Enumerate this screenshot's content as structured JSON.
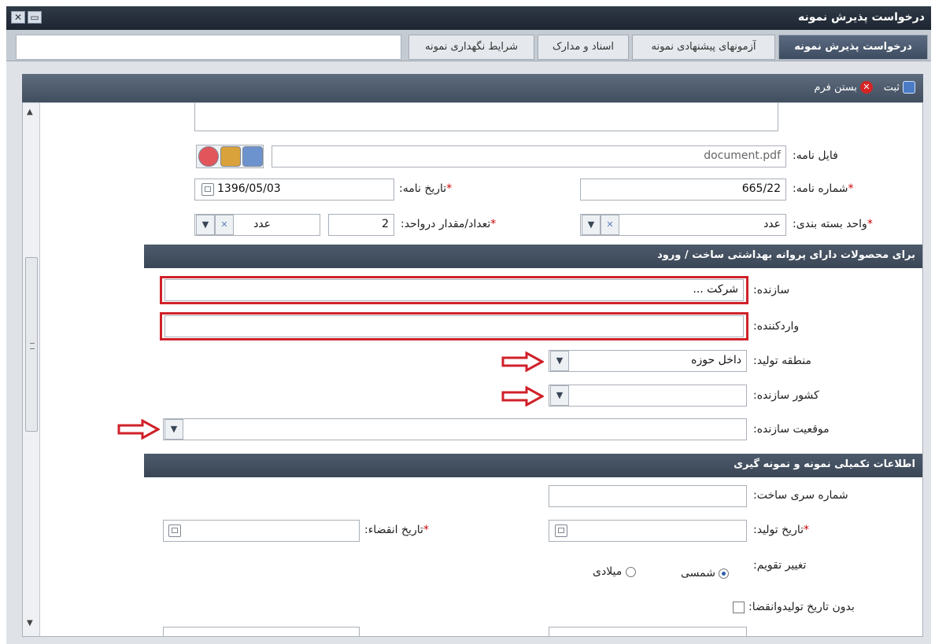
{
  "window": {
    "title": "درخواست پذیرش نمونه"
  },
  "tabs": [
    {
      "label": "درخواست پذیرش نمونه",
      "active": true
    },
    {
      "label": "آزمونهای پیشنهادی نمونه"
    },
    {
      "label": "اسناد و مدارک"
    },
    {
      "label": "شرایط نگهداری نمونه"
    }
  ],
  "toolbar": {
    "save_label": "ثبت",
    "close_label": "بستن فرم"
  },
  "form": {
    "file_label": "فایل نامه:",
    "file_value": "document.pdf",
    "letter_number_label": "شماره نامه:",
    "letter_number_value": "665/22",
    "letter_date_label": "تاریخ نامه:",
    "letter_date_value": "1396/05/03",
    "pack_unit_label": "واحد بسته بندی:",
    "pack_unit_value": "عدد",
    "qty_label": "تعداد/مقدار درواحد:",
    "qty_value": "2",
    "qty_unit_value": "عدد",
    "section1_title": "برای محصولات دارای پروانه بهداشتی ساخت / ورود",
    "manufacturer_label": "سازنده:",
    "manufacturer_value": "شرکت ...",
    "importer_label": "واردکننده:",
    "region_label": "منطقه تولید:",
    "region_value": "داخل حوزه",
    "country_label": "کشور سازنده:",
    "location_label": "موقعیت سازنده:",
    "section2_title": "اطلاعات تکمیلی نمونه و نمونه گیری",
    "batch_label": "شماره سری ساخت:",
    "prod_date_label": "تاریخ تولید:",
    "exp_date_label": "تاریخ انقضاء:",
    "calendar_label": "تغییر تقویم:",
    "calendar_shamsi": "شمسی",
    "calendar_miladi": "میلادی",
    "no_date_label": "بدون تاریخ تولیدوانقضا:"
  }
}
